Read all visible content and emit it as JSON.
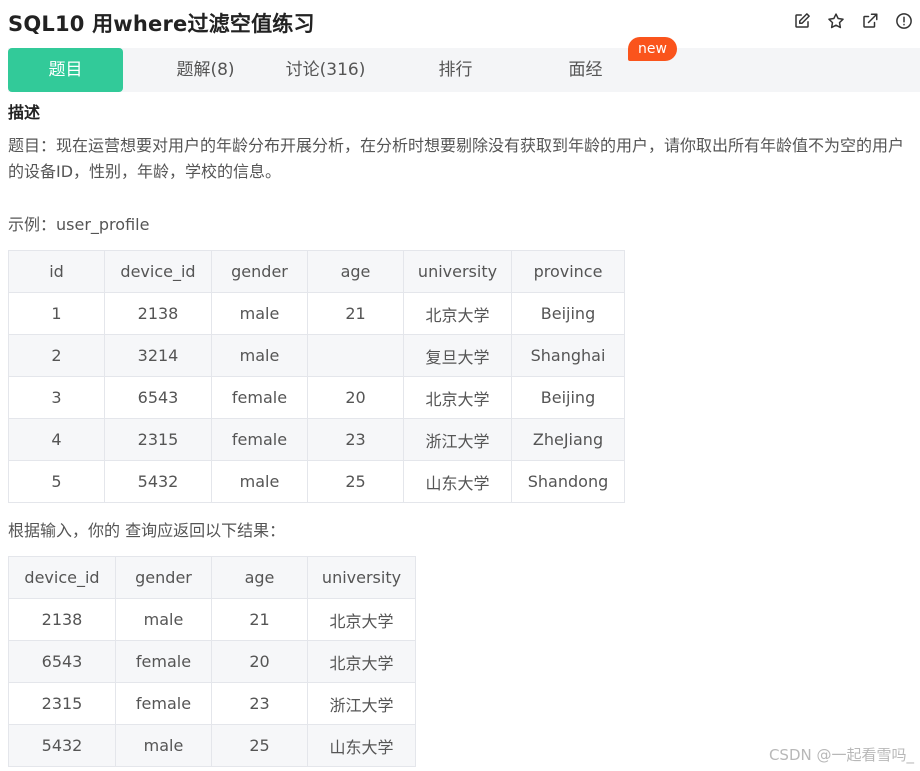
{
  "problem": {
    "title": "SQL10  用where过滤空值练习"
  },
  "actions": [
    "edit-icon",
    "star-icon",
    "share-icon",
    "report-icon"
  ],
  "tabs": [
    {
      "label": "题目",
      "active": true
    },
    {
      "label": "题解(8)"
    },
    {
      "label": "讨论(316)"
    },
    {
      "label": "排行"
    },
    {
      "label": "面经"
    }
  ],
  "new_badge": "new",
  "description": {
    "heading": "描述",
    "body": "题目：现在运营想要对用户的年龄分布开展分析，在分析时想要剔除没有获取到年龄的用户，请你取出所有年龄值不为空的用户的设备ID，性别，年龄，学校的信息。",
    "example_label": "示例：user_profile",
    "result_label": "根据输入，你的 查询应返回以下结果："
  },
  "example_table": {
    "headers": [
      "id",
      "device_id",
      "gender",
      "age",
      "university",
      "province"
    ],
    "rows": [
      [
        "1",
        "2138",
        "male",
        "21",
        "北京大学",
        "Beijing"
      ],
      [
        "2",
        "3214",
        "male",
        "",
        "复旦大学",
        "Shanghai"
      ],
      [
        "3",
        "6543",
        "female",
        "20",
        "北京大学",
        "Beijing"
      ],
      [
        "4",
        "2315",
        "female",
        "23",
        "浙江大学",
        "ZheJiang"
      ],
      [
        "5",
        "5432",
        "male",
        "25",
        "山东大学",
        "Shandong"
      ]
    ]
  },
  "result_table": {
    "headers": [
      "device_id",
      "gender",
      "age",
      "university"
    ],
    "rows": [
      [
        "2138",
        "male",
        "21",
        "北京大学"
      ],
      [
        "6543",
        "female",
        "20",
        "北京大学"
      ],
      [
        "2315",
        "female",
        "23",
        "浙江大学"
      ],
      [
        "5432",
        "male",
        "25",
        "山东大学"
      ]
    ]
  },
  "watermark": "CSDN @一起看雪吗_",
  "colors": {
    "accent": "#32ca99",
    "badge": "#fa541c"
  }
}
